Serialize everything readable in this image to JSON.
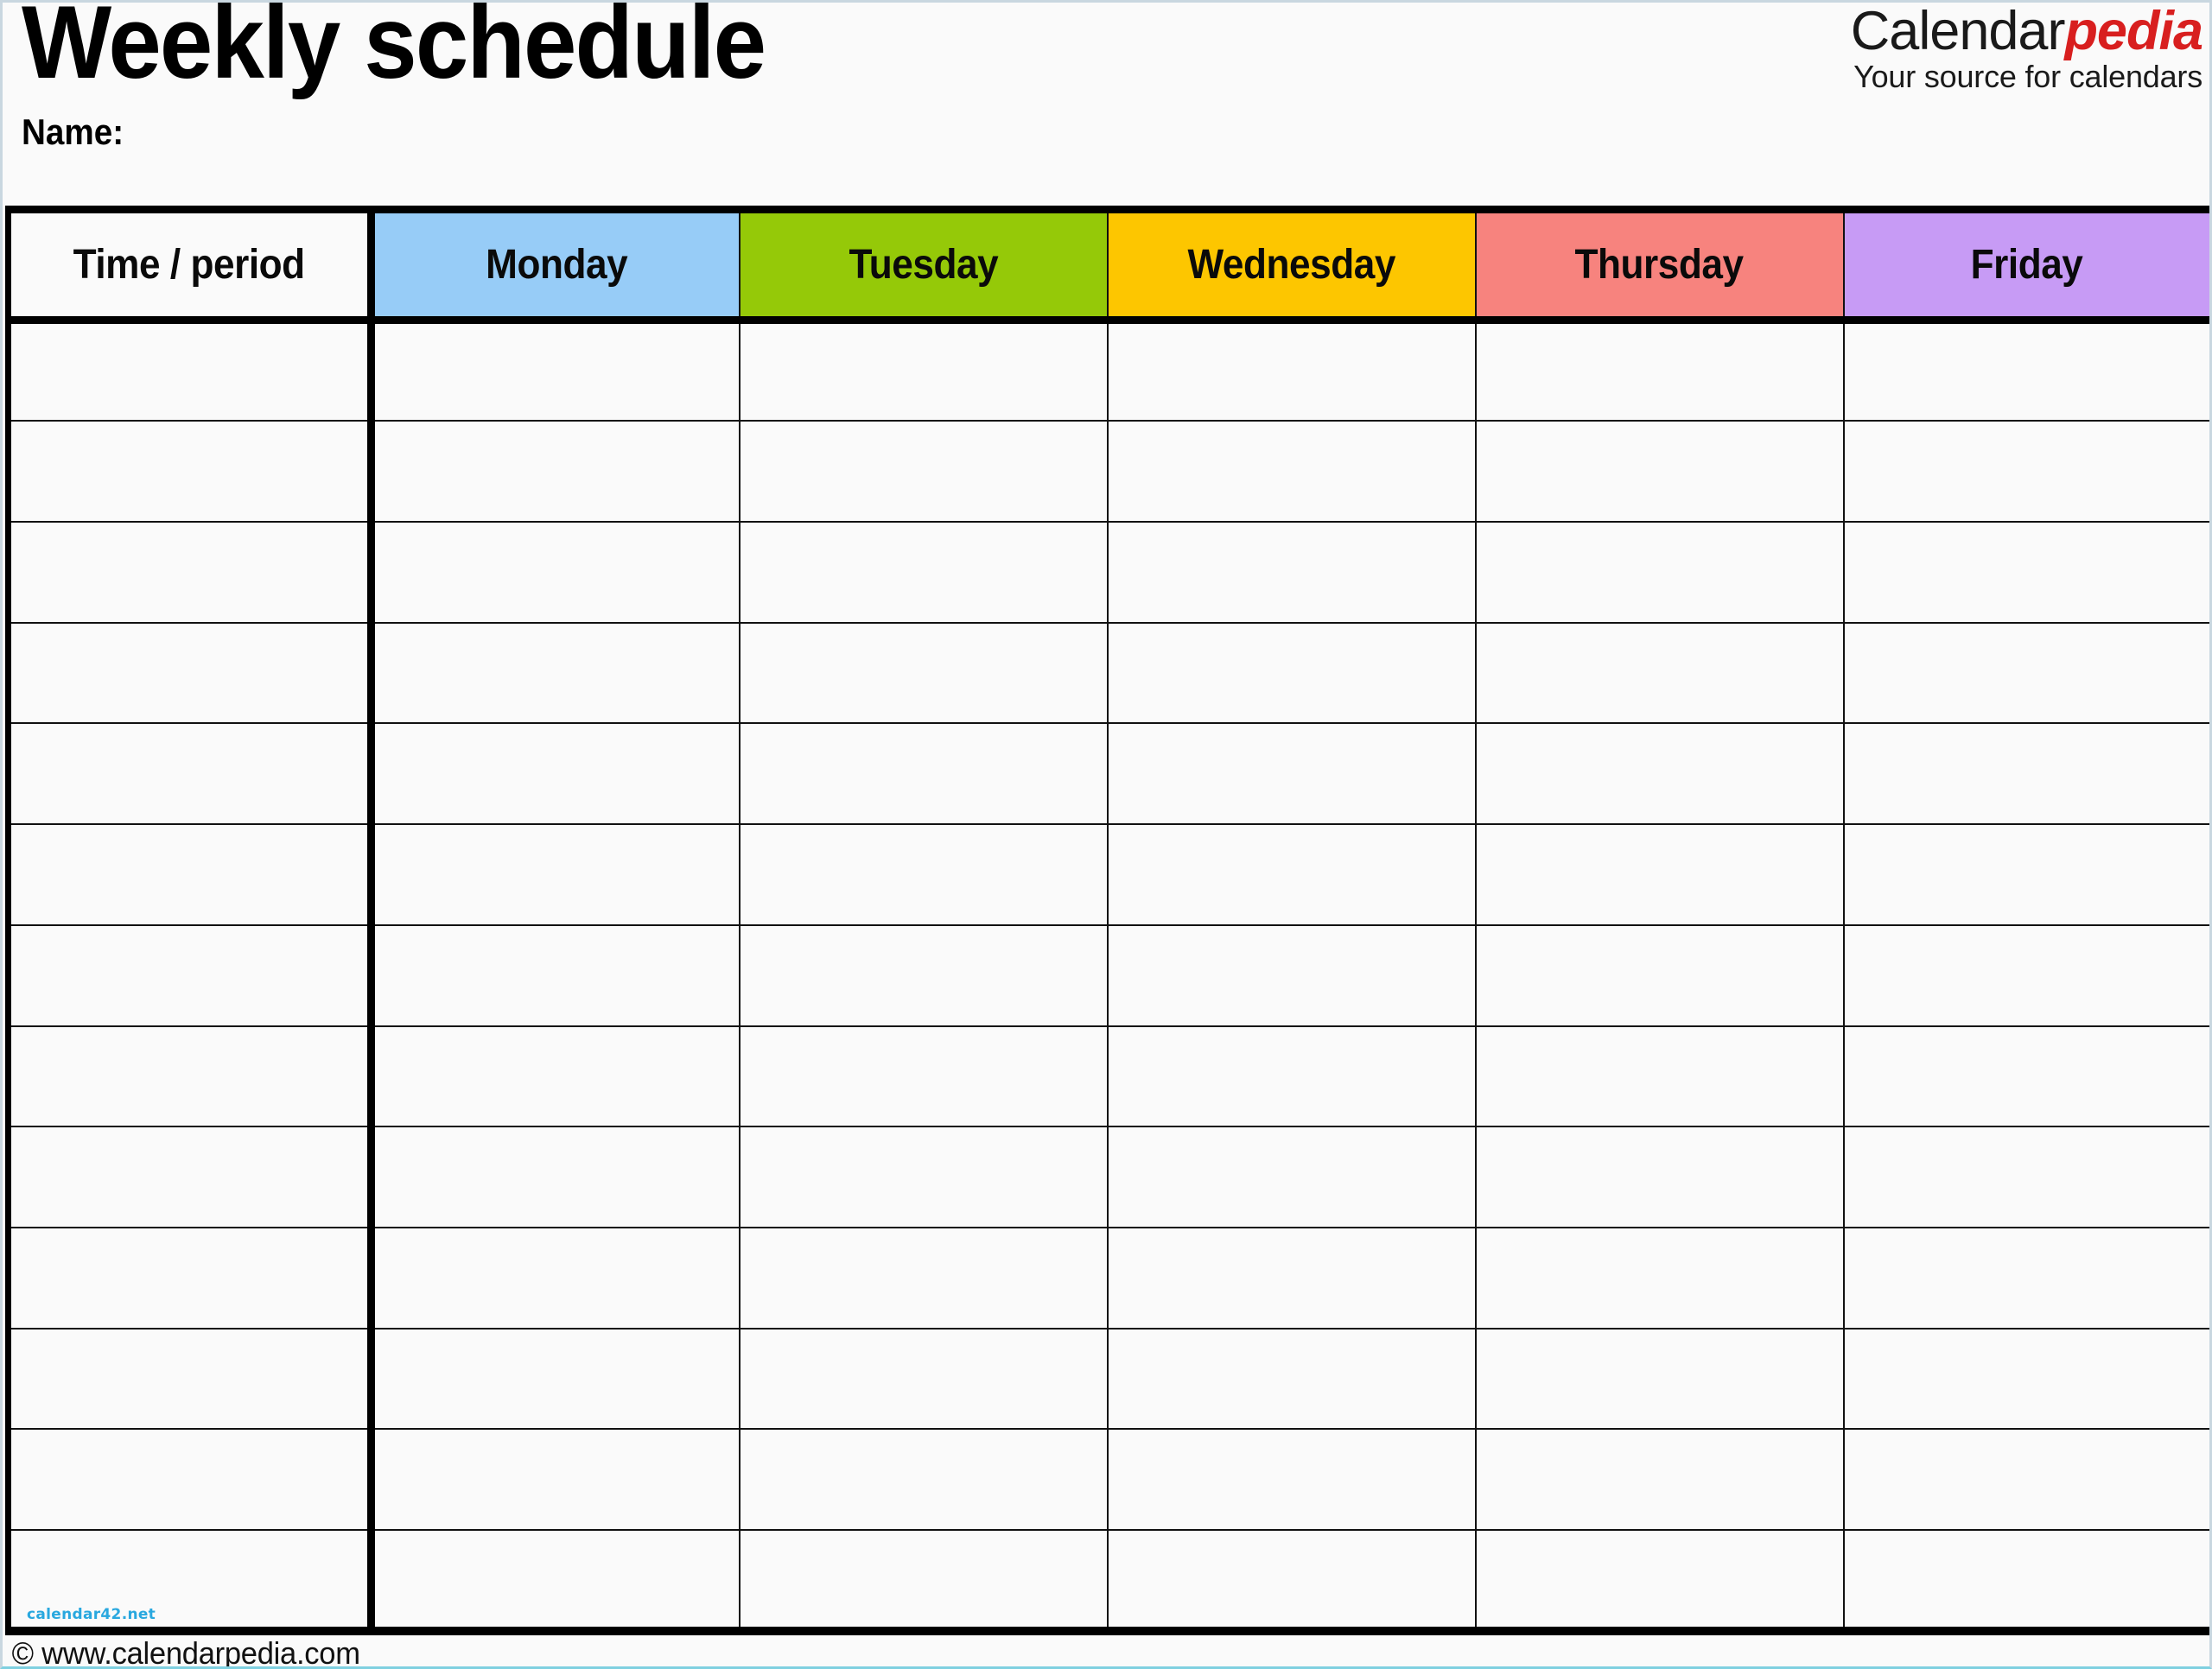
{
  "document": {
    "title": "Weekly schedule",
    "name_label": "Name:"
  },
  "brand": {
    "name_part1": "Calendar",
    "name_part2": "pedia",
    "tagline": "Your source for calendars",
    "accent_color": "#d81f1f",
    "text_color": "#1a1a1a"
  },
  "table": {
    "columns": [
      {
        "label": "Time / period",
        "bg": "#fafafa",
        "key": "time"
      },
      {
        "label": "Monday",
        "bg": "#97ccf7",
        "key": "monday"
      },
      {
        "label": "Tuesday",
        "bg": "#95c908",
        "key": "tuesday"
      },
      {
        "label": "Wednesday",
        "bg": "#fdc600",
        "key": "wednesday"
      },
      {
        "label": "Thursday",
        "bg": "#f7837e",
        "key": "thursday"
      },
      {
        "label": "Friday",
        "bg": "#c79bf5",
        "key": "friday"
      }
    ],
    "row_count": 13,
    "rows": [
      [
        "",
        "",
        "",
        "",
        "",
        ""
      ],
      [
        "",
        "",
        "",
        "",
        "",
        ""
      ],
      [
        "",
        "",
        "",
        "",
        "",
        ""
      ],
      [
        "",
        "",
        "",
        "",
        "",
        ""
      ],
      [
        "",
        "",
        "",
        "",
        "",
        ""
      ],
      [
        "",
        "",
        "",
        "",
        "",
        ""
      ],
      [
        "",
        "",
        "",
        "",
        "",
        ""
      ],
      [
        "",
        "",
        "",
        "",
        "",
        ""
      ],
      [
        "",
        "",
        "",
        "",
        "",
        ""
      ],
      [
        "",
        "",
        "",
        "",
        "",
        ""
      ],
      [
        "",
        "",
        "",
        "",
        "",
        ""
      ],
      [
        "",
        "",
        "",
        "",
        "",
        ""
      ],
      [
        "",
        "",
        "",
        "",
        "",
        ""
      ]
    ],
    "watermark": "calendar42.net",
    "watermark_color": "#29a8df",
    "border_color": "#000000"
  },
  "footer": {
    "copyright": "© www.calendarpedia.com"
  }
}
